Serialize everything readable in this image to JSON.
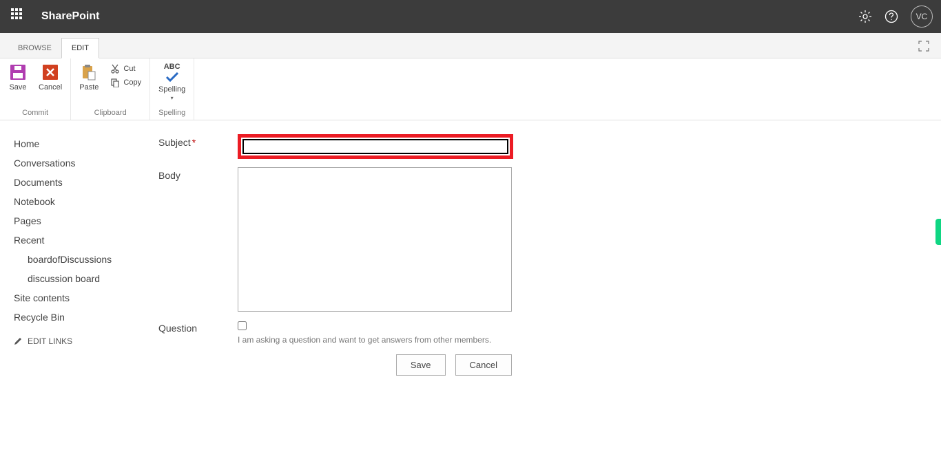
{
  "header": {
    "brand": "SharePoint",
    "avatar_initials": "VC"
  },
  "tabs": {
    "browse": "BROWSE",
    "edit": "EDIT"
  },
  "ribbon": {
    "commit": {
      "save": "Save",
      "cancel": "Cancel",
      "group_label": "Commit"
    },
    "clipboard": {
      "paste": "Paste",
      "cut": "Cut",
      "copy": "Copy",
      "group_label": "Clipboard"
    },
    "spelling": {
      "abc": "ABC",
      "spelling": "Spelling",
      "group_label": "Spelling"
    }
  },
  "nav": {
    "home": "Home",
    "conversations": "Conversations",
    "documents": "Documents",
    "notebook": "Notebook",
    "pages": "Pages",
    "recent": "Recent",
    "board_of_discussions": "boardofDiscussions",
    "discussion_board": "discussion board",
    "site_contents": "Site contents",
    "recycle_bin": "Recycle Bin",
    "edit_links": "EDIT LINKS"
  },
  "form": {
    "subject_label": "Subject",
    "subject_value": "",
    "body_label": "Body",
    "body_value": "",
    "question_label": "Question",
    "question_help": "I am asking a question and want to get answers from other members.",
    "save_button": "Save",
    "cancel_button": "Cancel"
  }
}
